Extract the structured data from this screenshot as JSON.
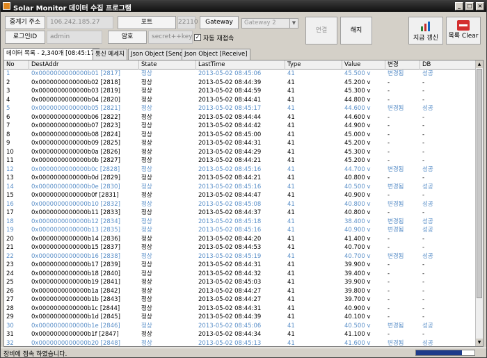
{
  "title": "Solar Monitor 데이터 수집 프로그램",
  "window_buttons": [
    "_",
    "□",
    "×"
  ],
  "form": {
    "relay_addr_label": "중계기 주소",
    "relay_addr_value": "106.242.185.27",
    "port_label": "포트",
    "port_value": "22110",
    "gateway_label": "Gateway",
    "gateway_value": "Gateway 2",
    "login_label": "로그인ID",
    "login_value": "admin",
    "password_label": "암호",
    "password_value": "secret++key",
    "auto_reconnect_label": "자동 재접속",
    "auto_reconnect_checked": "✓"
  },
  "buttons": {
    "connect": "연결",
    "disconnect": "해지",
    "refresh": "지금 갱신",
    "clear": "목록 Clear"
  },
  "tabs": [
    "데이터 목록 - 2,340개 [08:45:17]",
    "통신 메세지",
    "Json Object [Send]",
    "Json Object [Receive]"
  ],
  "columns": [
    "No",
    "DestAddr",
    "State",
    "LastTime",
    "Type",
    "Value",
    "변경",
    "DB"
  ],
  "rows": [
    [
      "1",
      "0x0000000000000b01 [2817]",
      "정상",
      "2013-05-02 08:45:06",
      "41",
      "45.500 v",
      "변경됨",
      "성공",
      true
    ],
    [
      "2",
      "0x0000000000000b02 [2818]",
      "정상",
      "2013-05-02 08:44:39",
      "41",
      "45.200 v",
      "-",
      "-",
      false
    ],
    [
      "3",
      "0x0000000000000b03 [2819]",
      "정상",
      "2013-05-02 08:44:59",
      "41",
      "45.300 v",
      "-",
      "-",
      false
    ],
    [
      "4",
      "0x0000000000000b04 [2820]",
      "정상",
      "2013-05-02 08:44:41",
      "41",
      "44.800 v",
      "-",
      "-",
      false
    ],
    [
      "5",
      "0x0000000000000b05 [2821]",
      "정상",
      "2013-05-02 08:45:17",
      "41",
      "44.600 v",
      "변경됨",
      "성공",
      true
    ],
    [
      "6",
      "0x0000000000000b06 [2822]",
      "정상",
      "2013-05-02 08:44:44",
      "41",
      "44.600 v",
      "-",
      "-",
      false
    ],
    [
      "7",
      "0x0000000000000b07 [2823]",
      "정상",
      "2013-05-02 08:44:42",
      "41",
      "44.900 v",
      "-",
      "-",
      false
    ],
    [
      "8",
      "0x0000000000000b08 [2824]",
      "정상",
      "2013-05-02 08:45:00",
      "41",
      "45.000 v",
      "-",
      "-",
      false
    ],
    [
      "9",
      "0x0000000000000b09 [2825]",
      "정상",
      "2013-05-02 08:44:31",
      "41",
      "45.200 v",
      "-",
      "-",
      false
    ],
    [
      "10",
      "0x0000000000000b0a [2826]",
      "정상",
      "2013-05-02 08:44:29",
      "41",
      "45.300 v",
      "-",
      "-",
      false
    ],
    [
      "11",
      "0x0000000000000b0b [2827]",
      "정상",
      "2013-05-02 08:44:21",
      "41",
      "45.200 v",
      "-",
      "-",
      false
    ],
    [
      "12",
      "0x0000000000000b0c [2828]",
      "정상",
      "2013-05-02 08:45:16",
      "41",
      "44.700 v",
      "변경됨",
      "성공",
      true
    ],
    [
      "13",
      "0x0000000000000b0d [2829]",
      "정상",
      "2013-05-02 08:44:21",
      "41",
      "40.800 v",
      "-",
      "-",
      false
    ],
    [
      "14",
      "0x0000000000000b0e [2830]",
      "정상",
      "2013-05-02 08:45:16",
      "41",
      "40.500 v",
      "변경됨",
      "성공",
      true
    ],
    [
      "15",
      "0x0000000000000b0f [2831]",
      "정상",
      "2013-05-02 08:44:47",
      "41",
      "40.900 v",
      "-",
      "-",
      false
    ],
    [
      "16",
      "0x0000000000000b10 [2832]",
      "정상",
      "2013-05-02 08:45:08",
      "41",
      "40.800 v",
      "변경됨",
      "성공",
      true
    ],
    [
      "17",
      "0x0000000000000b11 [2833]",
      "정상",
      "2013-05-02 08:44:37",
      "41",
      "40.800 v",
      "-",
      "-",
      false
    ],
    [
      "18",
      "0x0000000000000b12 [2834]",
      "정상",
      "2013-05-02 08:45:18",
      "41",
      "38.400 v",
      "변경됨",
      "성공",
      true
    ],
    [
      "19",
      "0x0000000000000b13 [2835]",
      "정상",
      "2013-05-02 08:45:16",
      "41",
      "40.900 v",
      "변경됨",
      "성공",
      true
    ],
    [
      "20",
      "0x0000000000000b14 [2836]",
      "정상",
      "2013-05-02 08:44:20",
      "41",
      "41.400 v",
      "-",
      "-",
      false
    ],
    [
      "21",
      "0x0000000000000b15 [2837]",
      "정상",
      "2013-05-02 08:44:53",
      "41",
      "40.700 v",
      "-",
      "-",
      false
    ],
    [
      "22",
      "0x0000000000000b16 [2838]",
      "정상",
      "2013-05-02 08:45:19",
      "41",
      "40.700 v",
      "변경됨",
      "성공",
      true
    ],
    [
      "23",
      "0x0000000000000b17 [2839]",
      "정상",
      "2013-05-02 08:44:31",
      "41",
      "39.900 v",
      "-",
      "-",
      false
    ],
    [
      "24",
      "0x0000000000000b18 [2840]",
      "정상",
      "2013-05-02 08:44:32",
      "41",
      "39.400 v",
      "-",
      "-",
      false
    ],
    [
      "25",
      "0x0000000000000b19 [2841]",
      "정상",
      "2013-05-02 08:45:03",
      "41",
      "39.900 v",
      "-",
      "-",
      false
    ],
    [
      "26",
      "0x0000000000000b1a [2842]",
      "정상",
      "2013-05-02 08:44:27",
      "41",
      "39.800 v",
      "-",
      "-",
      false
    ],
    [
      "27",
      "0x0000000000000b1b [2843]",
      "정상",
      "2013-05-02 08:44:27",
      "41",
      "39.700 v",
      "-",
      "-",
      false
    ],
    [
      "28",
      "0x0000000000000b1c [2844]",
      "정상",
      "2013-05-02 08:44:31",
      "41",
      "40.900 v",
      "-",
      "-",
      false
    ],
    [
      "29",
      "0x0000000000000b1d [2845]",
      "정상",
      "2013-05-02 08:44:39",
      "41",
      "40.100 v",
      "-",
      "-",
      false
    ],
    [
      "30",
      "0x0000000000000b1e [2846]",
      "정상",
      "2013-05-02 08:45:06",
      "41",
      "40.500 v",
      "변경됨",
      "성공",
      true
    ],
    [
      "31",
      "0x0000000000000b1f [2847]",
      "정상",
      "2013-05-02 08:44:34",
      "41",
      "41.100 v",
      "-",
      "-",
      false
    ],
    [
      "32",
      "0x0000000000000b20 [2848]",
      "정상",
      "2013-05-02 08:45:13",
      "41",
      "41.600 v",
      "변경됨",
      "성공",
      true
    ]
  ],
  "status": {
    "text": "장비에 접속 하였습니다.",
    "progress": 0.78
  },
  "colors": {
    "highlight_row": "#5a8fc8",
    "progress_fill": "#1e3a8a",
    "clear_icon": "#d32f2f"
  }
}
